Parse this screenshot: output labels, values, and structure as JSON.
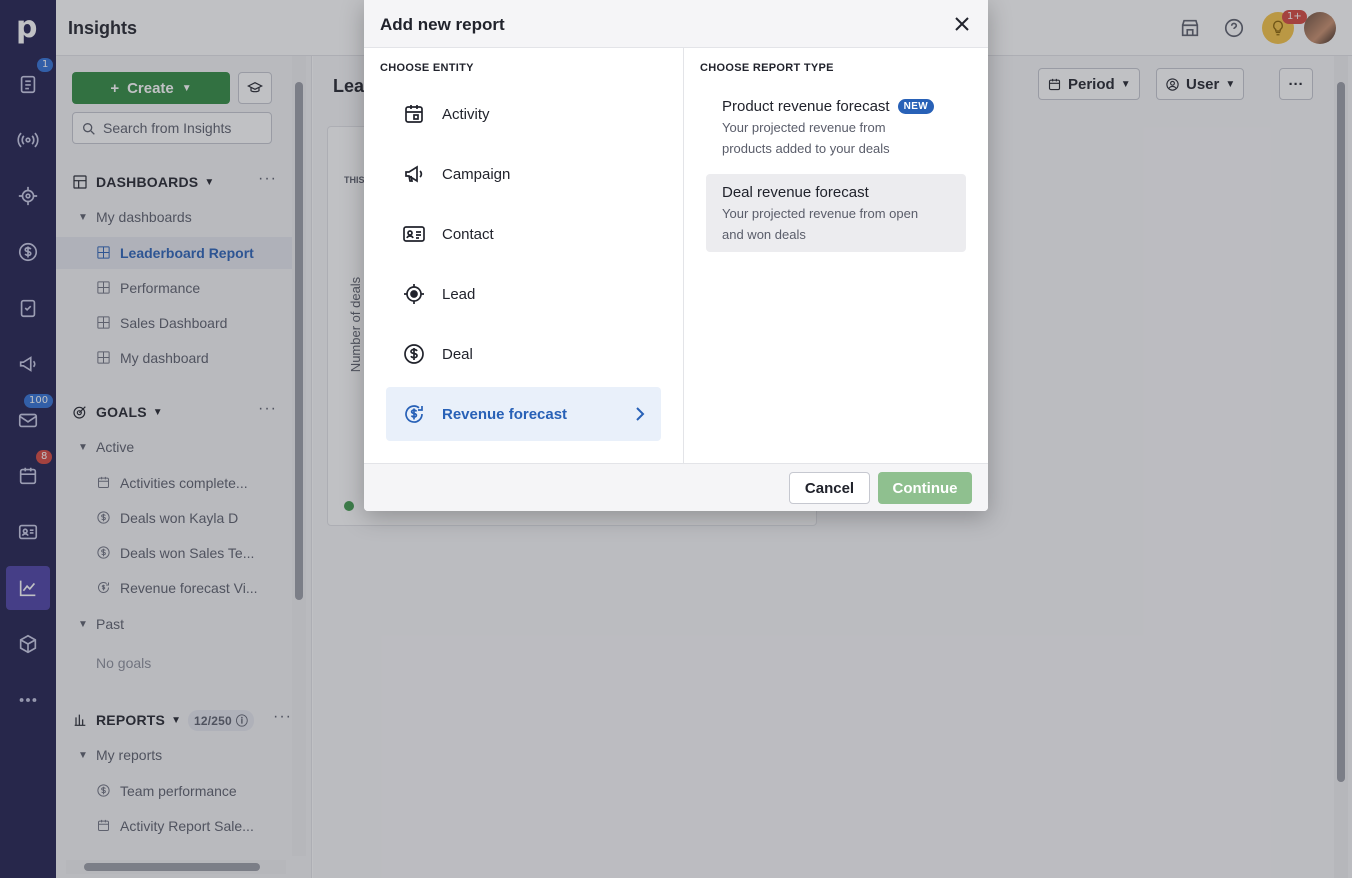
{
  "app": {
    "title": "Insights",
    "logo": "p",
    "rail_badges": {
      "activities": "1",
      "mail": "100",
      "calendar": "8"
    },
    "topbar_badge": "1+"
  },
  "sidebar": {
    "create_label": "Create",
    "search_placeholder": "Search from Insights",
    "dashboards": {
      "header": "DASHBOARDS",
      "group": "My dashboards",
      "items": [
        "Leaderboard Report",
        "Performance",
        "Sales Dashboard",
        "My dashboard"
      ]
    },
    "goals": {
      "header": "GOALS",
      "group_active": "Active",
      "items": [
        "Activities complete...",
        "Deals won Kayla D",
        "Deals won Sales Te...",
        "Revenue forecast Vi..."
      ],
      "group_past": "Past",
      "empty": "No goals"
    },
    "reports": {
      "header": "REPORTS",
      "counter": "12/250",
      "group": "My reports",
      "items": [
        "Team performance",
        "Activity Report Sale..."
      ]
    }
  },
  "main": {
    "header": "Lea",
    "period_label": "Period",
    "user_label": "User",
    "card_caption": "THIS",
    "axis_label": "Number of deals"
  },
  "modal": {
    "title": "Add new report",
    "choose_entity_label": "CHOOSE ENTITY",
    "choose_report_label": "CHOOSE REPORT TYPE",
    "entities": [
      {
        "label": "Activity",
        "icon": "calendar-icon"
      },
      {
        "label": "Campaign",
        "icon": "megaphone-icon"
      },
      {
        "label": "Contact",
        "icon": "contact-card-icon"
      },
      {
        "label": "Lead",
        "icon": "target-icon"
      },
      {
        "label": "Deal",
        "icon": "dollar-icon"
      },
      {
        "label": "Revenue forecast",
        "icon": "revenue-forecast-icon"
      }
    ],
    "report_types": [
      {
        "title": "Product revenue forecast",
        "tag": "NEW",
        "desc_line1": "Your projected revenue from",
        "desc_line2": "products added to your deals"
      },
      {
        "title": "Deal revenue forecast",
        "desc_line1": "Your projected revenue from open",
        "desc_line2": "and won deals"
      }
    ],
    "cancel_label": "Cancel",
    "continue_label": "Continue"
  },
  "colors": {
    "rail": "#1e1c4d",
    "create": "#2f8a3e",
    "accent": "#2861b7",
    "continue_disabled": "#8fc08f"
  }
}
